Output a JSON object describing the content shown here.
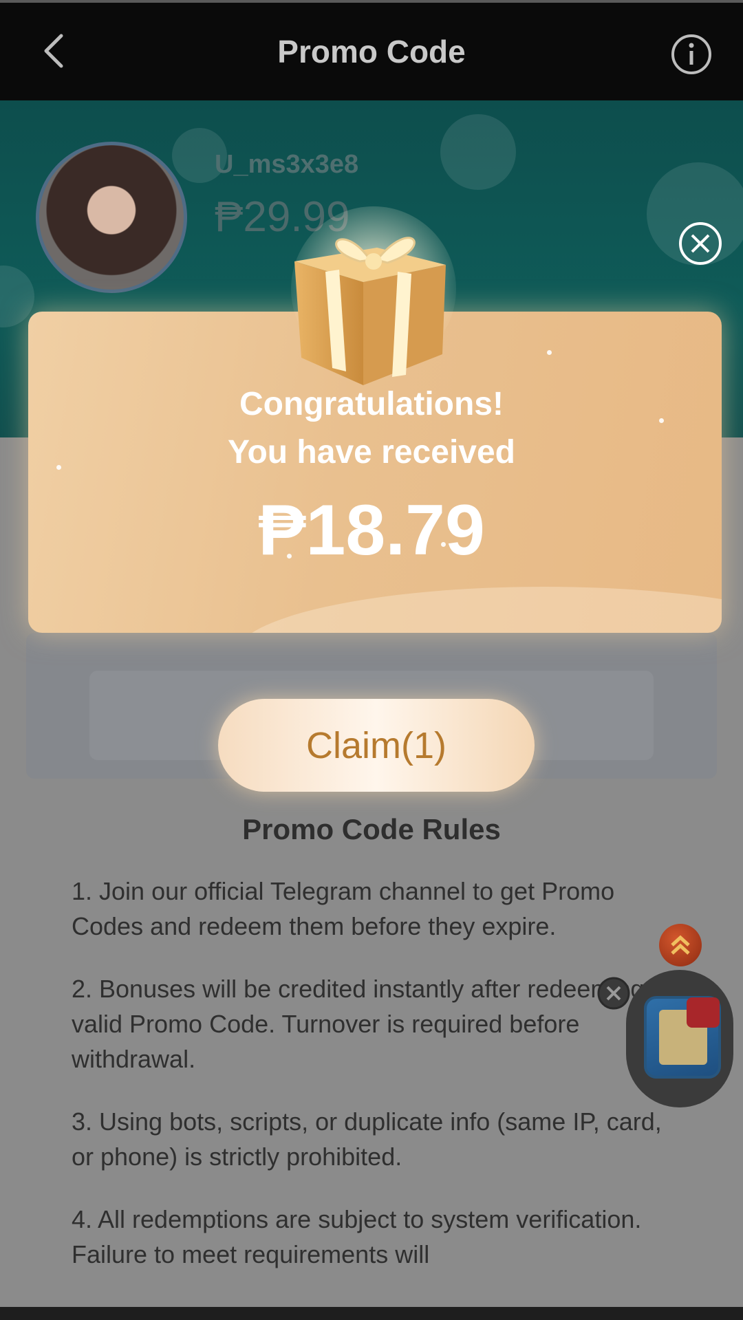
{
  "header": {
    "title": "Promo Code",
    "back_icon": "chevron-left-icon",
    "info_icon": "info-icon"
  },
  "profile": {
    "username": "U_ms3x3e8",
    "balance": "₱29.99"
  },
  "modal": {
    "congrats_line1": "Congratulations!",
    "congrats_line2": "You have received",
    "amount": "₱18.79",
    "claim_label": "Claim(1)",
    "close_icon": "close-icon"
  },
  "rules": {
    "title": "Promo Code Rules",
    "items": [
      "1. Join our official Telegram channel to get Promo Codes and redeem them before they expire.",
      "2. Bonuses will be credited instantly after redeeming a valid Promo Code. Turnover is required before withdrawal.",
      "3. Using bots, scripts, or duplicate info (same IP, card, or phone) is strictly prohibited.",
      "4. All redemptions are subject to system verification. Failure to meet requirements will"
    ]
  },
  "colors": {
    "header_bg": "#0a0a0a",
    "hero_bg": "#0f5b58",
    "modal_gold": "#e9c08f",
    "claim_text": "#b67a2e"
  }
}
